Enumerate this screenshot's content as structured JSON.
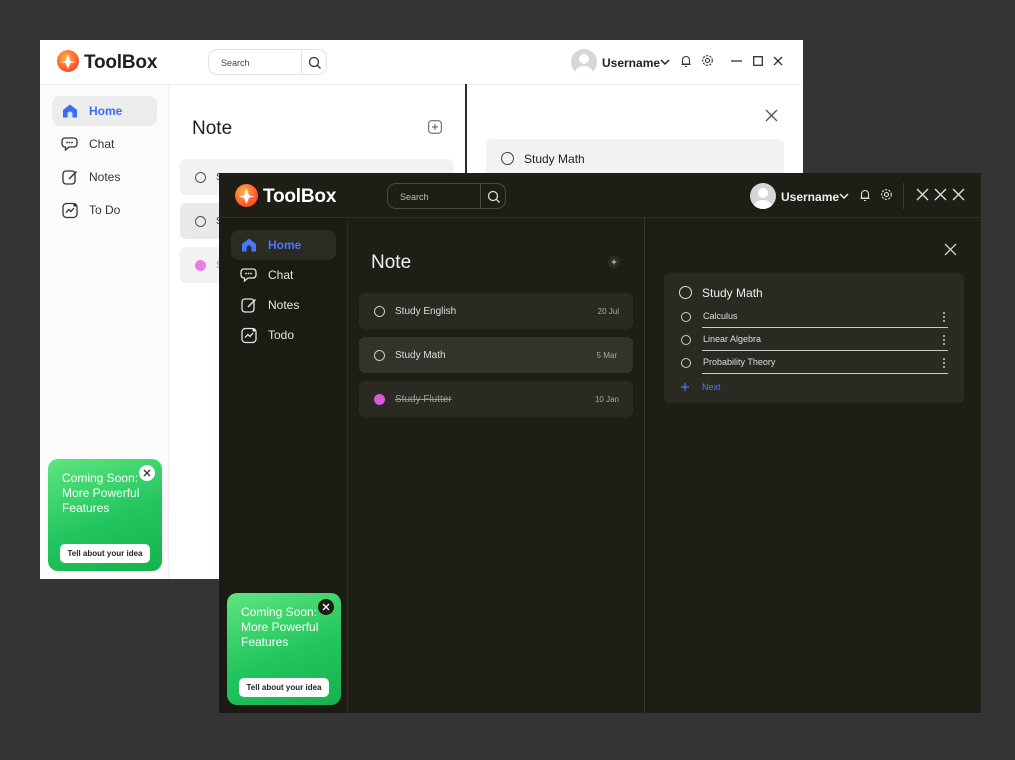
{
  "app": {
    "name": "ToolBox",
    "username": "Username"
  },
  "search": {
    "placeholder": "Search"
  },
  "nav": {
    "light": [
      {
        "label": "Home",
        "icon": "home-icon",
        "active": true
      },
      {
        "label": "Chat",
        "icon": "chat-icon"
      },
      {
        "label": "Notes",
        "icon": "notes-icon"
      },
      {
        "label": "To Do",
        "icon": "todo-icon"
      }
    ],
    "dark": [
      {
        "label": "Home",
        "icon": "home-icon",
        "active": true
      },
      {
        "label": "Chat",
        "icon": "chat-icon"
      },
      {
        "label": "Notes",
        "icon": "notes-icon"
      },
      {
        "label": "Todo",
        "icon": "todo-icon"
      }
    ]
  },
  "promo": {
    "text": "Coming Soon: More Powerful Features",
    "button": "Tell about your idea"
  },
  "notes": {
    "title": "Note",
    "items": [
      {
        "title": "Study English",
        "date": "20 Jul",
        "done": false
      },
      {
        "title": "Study Math",
        "date": "5 Mar",
        "done": false
      },
      {
        "title": "Study Flutter",
        "date": "10 Jan",
        "done": true
      }
    ]
  },
  "detail": {
    "title": "Study Math",
    "subitems": [
      "Calculus",
      "Linear Algebra",
      "Probability Theory"
    ],
    "next_label": "Next"
  },
  "light_partial_note_prefix": "S",
  "colors": {
    "accent": "#3b6df2",
    "green": "#22c55e",
    "done_check": "#d65ad9",
    "dark_bg": "#1e1e16"
  }
}
